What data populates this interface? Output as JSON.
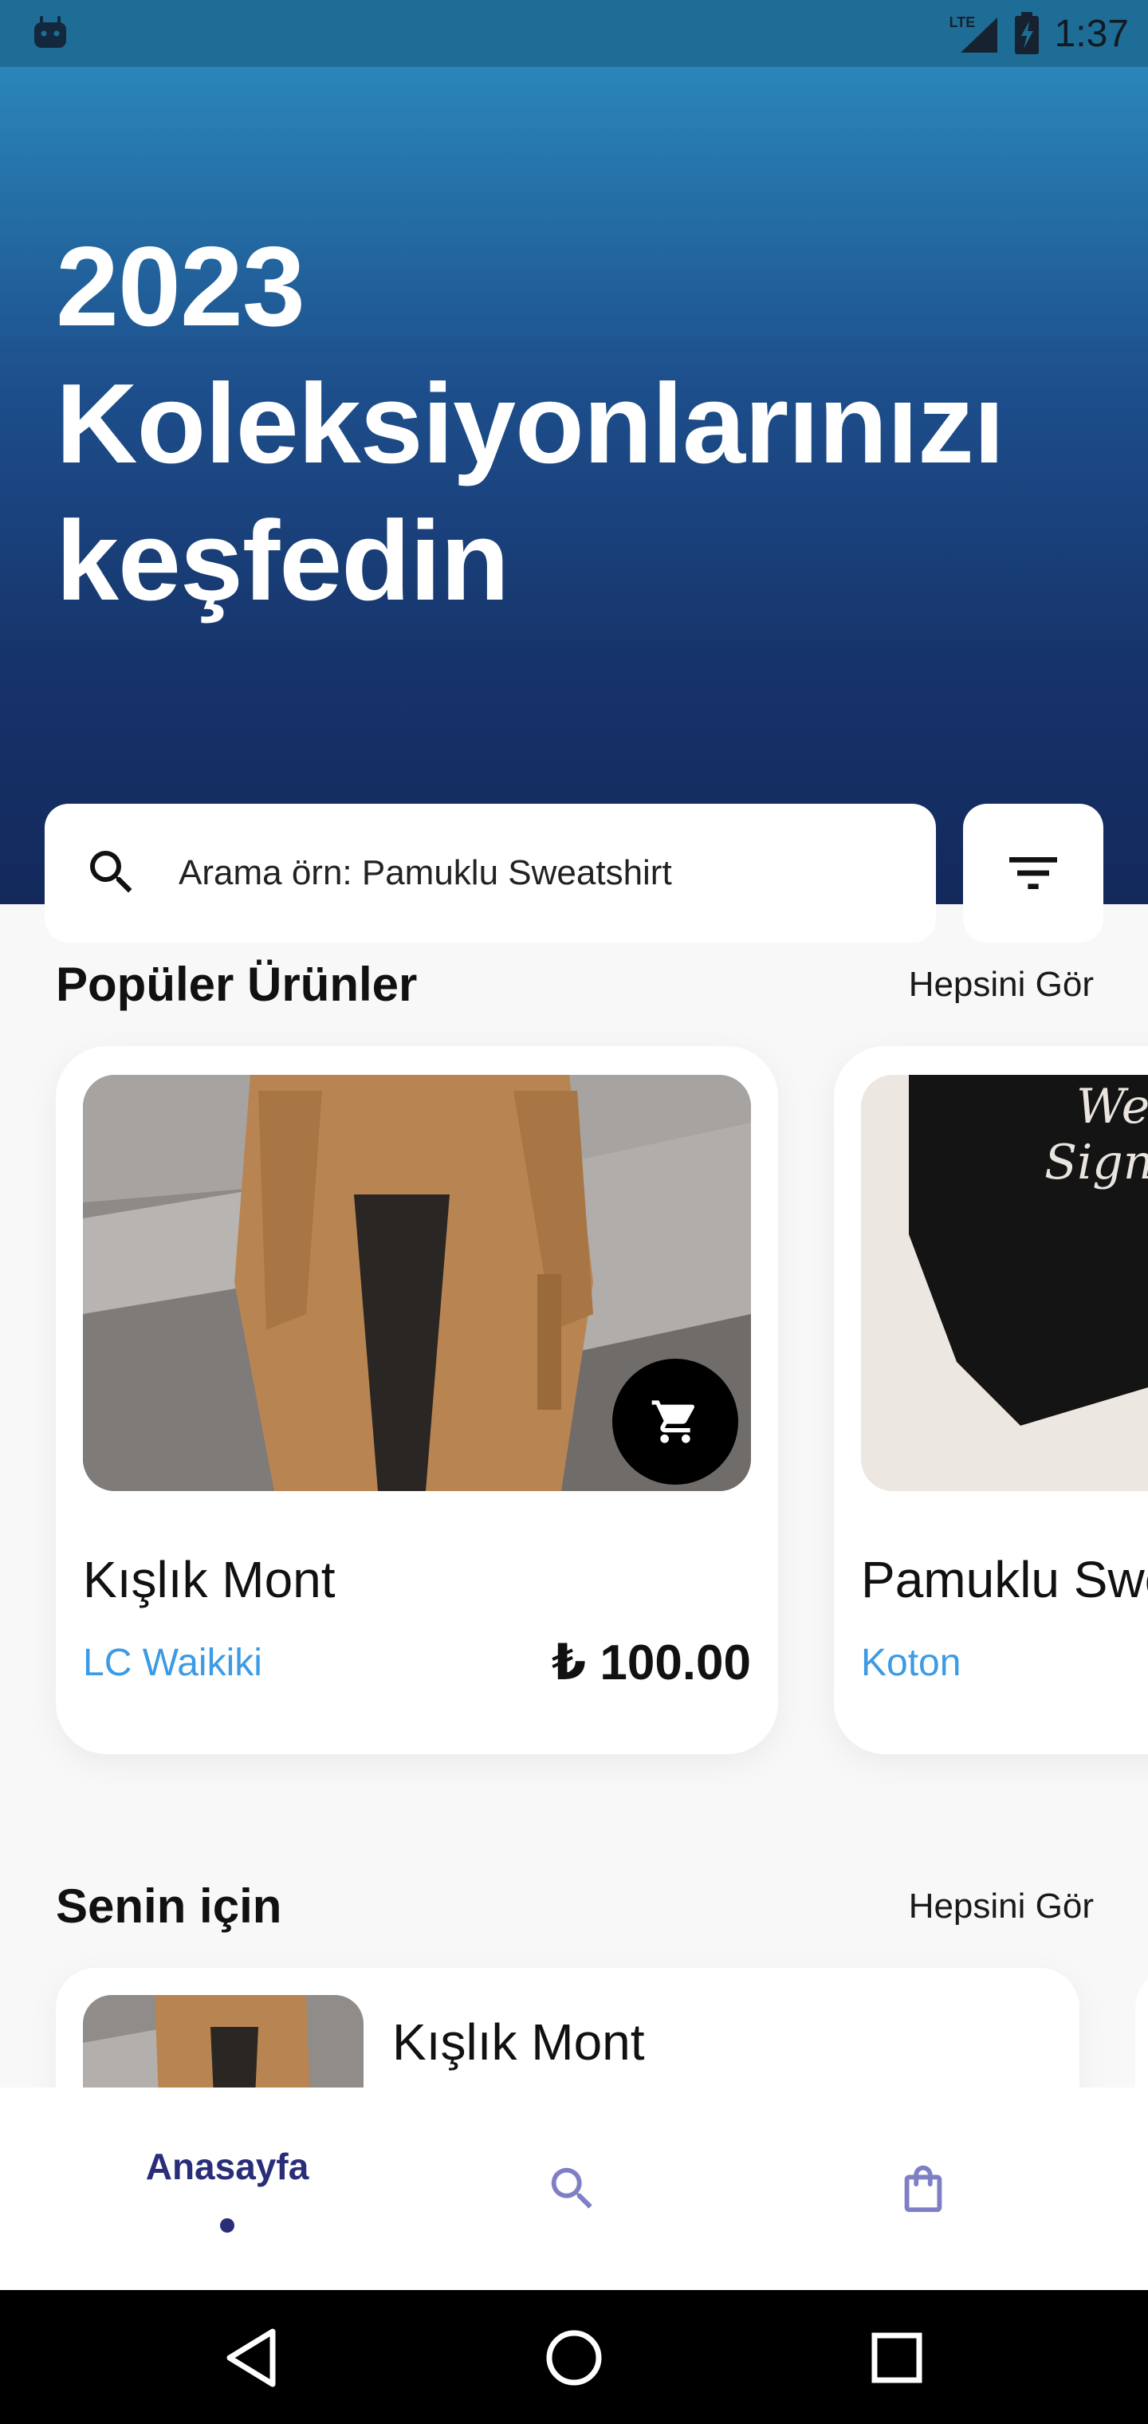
{
  "status_bar": {
    "time": "1:37",
    "network": "LTE"
  },
  "hero": {
    "title_lines": [
      "2023",
      "Koleksiyonlarınızı",
      "keşfedin"
    ]
  },
  "search": {
    "placeholder": "Arama örn: Pamuklu Sweatshirt"
  },
  "popular": {
    "title": "Popüler Ürünler",
    "see_all": "Hepsini Gör",
    "products": [
      {
        "name": "Kışlık Mont",
        "brand": "LC Waikiki",
        "price": "₺ 100.00"
      },
      {
        "name": "Pamuklu Swe",
        "brand": "Koton",
        "price": ""
      }
    ]
  },
  "for_you": {
    "title": "Senin için",
    "see_all": "Hepsini Gör",
    "items": [
      {
        "name": "Kışlık Mont"
      }
    ]
  },
  "bottom_nav": {
    "home_label": "Anasayfa",
    "search_icon": "search-icon",
    "bag_icon": "shopping-bag-icon"
  },
  "colors": {
    "hero_top": "#2a86ba",
    "hero_bottom": "#13295c",
    "brand_blue": "#3c9be4",
    "nav_active": "#2a2d78"
  }
}
